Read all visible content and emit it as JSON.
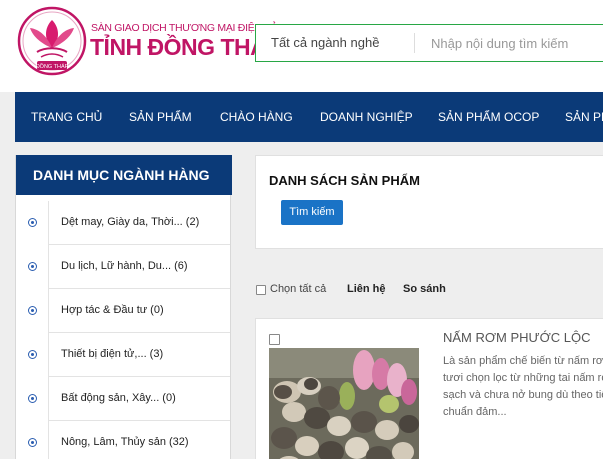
{
  "header": {
    "logo_subtitle": "SÀN GIAO DỊCH THƯƠNG MẠI ĐIỆN TỬ",
    "logo_title": "TỈNH ĐỒNG THÁP",
    "logo_emblem_text": "ĐỒNG THÁP",
    "search_category": "Tất cả ngành nghề",
    "search_placeholder": "Nhập nội dung tìm kiếm"
  },
  "nav": {
    "items": [
      "TRANG CHỦ",
      "SẢN PHẨM",
      "CHÀO HÀNG",
      "DOANH NGHIỆP",
      "SẢN PHẨM OCOP",
      "SẢN PH"
    ]
  },
  "sidebar": {
    "title": "DANH MỤC NGÀNH HÀNG",
    "items": [
      {
        "label": "Dệt may, Giày da, Thời... (2)"
      },
      {
        "label": "Du lịch, Lữ hành, Du... (6)"
      },
      {
        "label": "Hợp tác & Đầu tư (0)"
      },
      {
        "label": "Thiết bị điện tử,... (3)"
      },
      {
        "label": "Bất động sản, Xây... (0)"
      },
      {
        "label": "Nông, Lâm, Thủy sản (32)"
      }
    ]
  },
  "main": {
    "title": "DANH SÁCH SẢN PHẨM",
    "search_button": "Tìm kiếm",
    "select_all": "Chọn tất cả",
    "contact": "Liên hệ",
    "compare": "So sánh"
  },
  "product": {
    "name": "NẤM RƠM PHƯỚC LỘC",
    "description": "Là sản phẩm chế biến từ nấm rơm tươi chọn lọc từ những tai nấm rơm sạch và chưa nở bung dù theo tiêu chuẩn đảm..."
  },
  "colors": {
    "brand_pink": "#c01565",
    "nav_blue": "#0b3a78",
    "button_blue": "#1a73c6",
    "search_border_green": "#28a745"
  }
}
